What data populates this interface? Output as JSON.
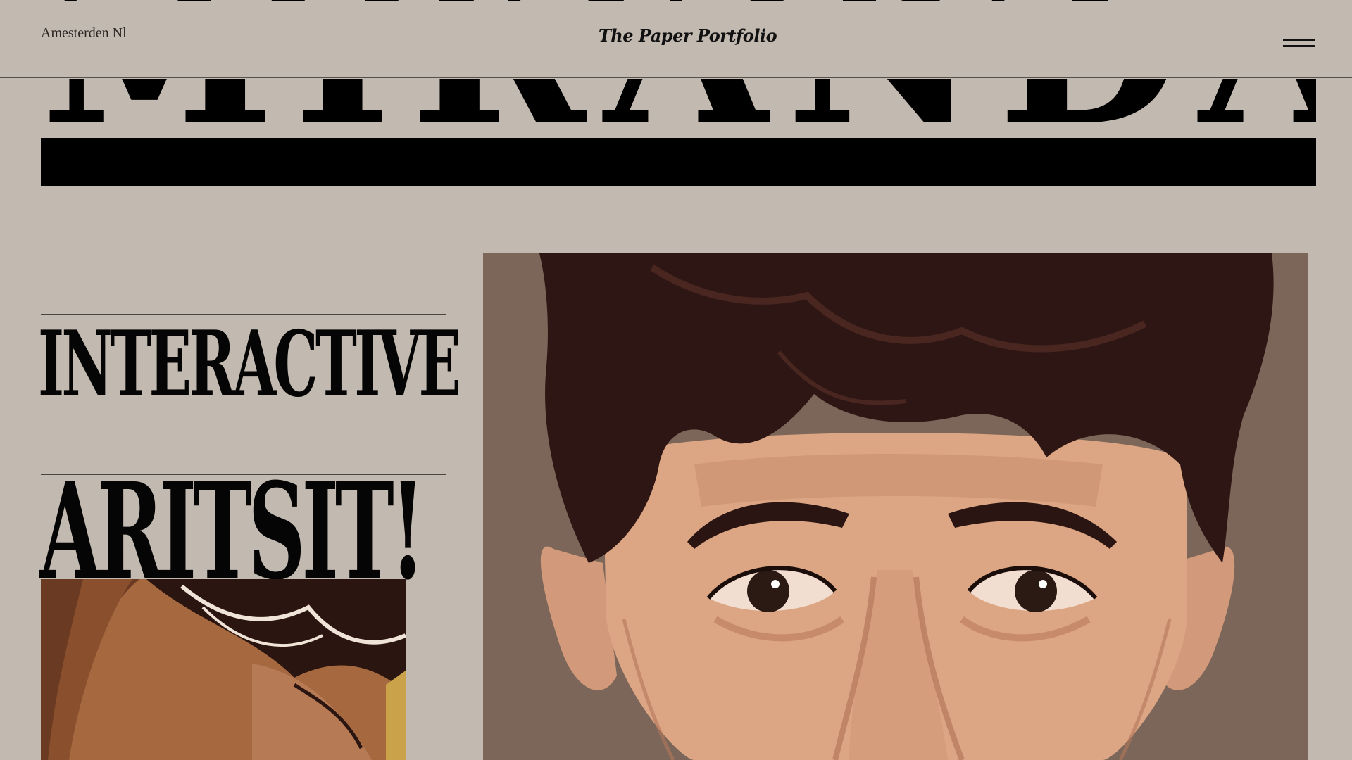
{
  "header": {
    "location": "Amesterden Nl",
    "site_title": "The Paper Portfolio",
    "menu_label": "menu"
  },
  "banner": {
    "word": "MIRANDA"
  },
  "headline": {
    "line1": "INTERACTIVE",
    "line2": "ARITSIT!"
  },
  "colors": {
    "background": "#c2b9b0",
    "ink": "#000000",
    "artwork_backdrop": "#7b6659",
    "hair": "#2a1410",
    "skin": "#d9a07f"
  },
  "icons": {
    "menu": "hamburger-icon"
  }
}
